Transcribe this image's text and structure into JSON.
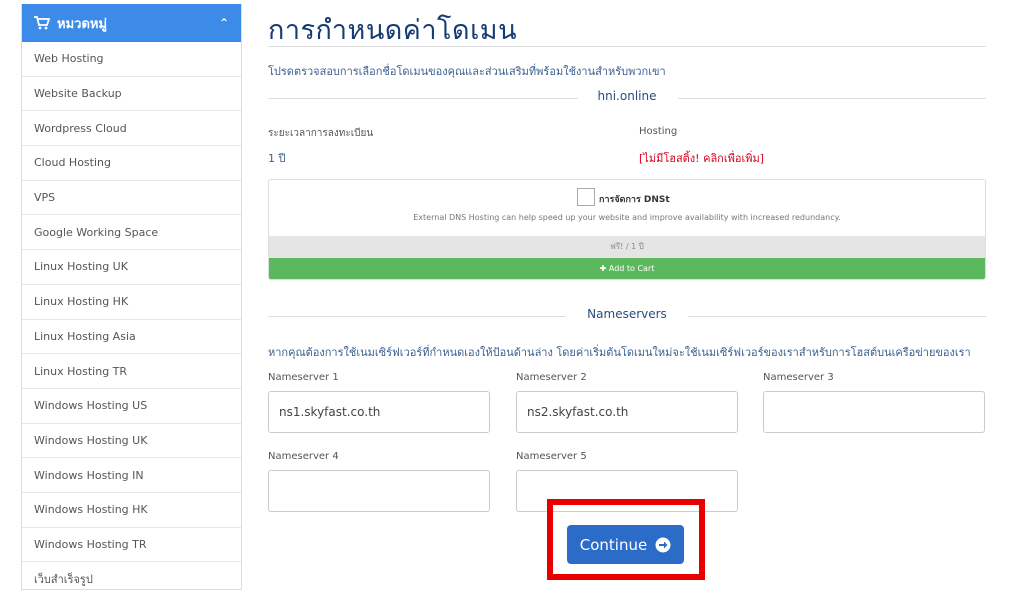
{
  "sidebar": {
    "header": "หมวดหมู่",
    "items": [
      {
        "label": "Web Hosting"
      },
      {
        "label": "Website Backup"
      },
      {
        "label": "Wordpress Cloud"
      },
      {
        "label": "Cloud Hosting"
      },
      {
        "label": "VPS"
      },
      {
        "label": "Google Working Space"
      },
      {
        "label": "Linux Hosting UK"
      },
      {
        "label": "Linux Hosting HK"
      },
      {
        "label": "Linux Hosting Asia"
      },
      {
        "label": "Linux Hosting TR"
      },
      {
        "label": "Windows Hosting US"
      },
      {
        "label": "Windows Hosting UK"
      },
      {
        "label": "Windows Hosting IN"
      },
      {
        "label": "Windows Hosting HK"
      },
      {
        "label": "Windows Hosting TR"
      },
      {
        "label": "เว็บสำเร็จรูป"
      }
    ]
  },
  "main": {
    "title": "การกำหนดค่าโดเมน",
    "subtitle": "โปรดตรวจสอบการเลือกชื่อโดเมนของคุณและส่วนเสริมที่พร้อมใช้งานสำหรับพวกเขา",
    "domain": "hni.online",
    "registration_label": "ระยะเวลาการลงทะเบียน",
    "registration_value": "1 ปี",
    "hosting_label": "Hosting",
    "hosting_value": "[ไม่มีโฮสติ้ง! คลิกเพื่อเพิ่ม]",
    "dns": {
      "title": "การจัดการ DNSt",
      "description": "External DNS Hosting can help speed up your website and improve availability with increased redundancy.",
      "price": "ฟรี! / 1 ปี",
      "add_to_cart": "Add to Cart"
    },
    "nameservers_heading": "Nameservers",
    "nameservers_desc": "หากคุณต้องการใช้เนมเซิร์ฟเวอร์ที่กำหนดเองให้ป้อนด้านล่าง โดยค่าเริ่มต้นโดเมนใหม่จะใช้เนมเซิร์ฟเวอร์ของเราสำหรับการโฮสต์บนเครือข่ายของเรา",
    "nameservers": [
      {
        "label": "Nameserver 1",
        "value": "ns1.skyfast.co.th"
      },
      {
        "label": "Nameserver 2",
        "value": "ns2.skyfast.co.th"
      },
      {
        "label": "Nameserver 3",
        "value": ""
      },
      {
        "label": "Nameserver 4",
        "value": ""
      },
      {
        "label": "Nameserver 5",
        "value": ""
      }
    ],
    "continue_label": "Continue"
  },
  "colors": {
    "sidebar_header": "#3d8be8",
    "title": "#173c73",
    "hosting_link": "#d9001b",
    "add_to_cart": "#5cb85c",
    "continue_button": "#2a6cc8",
    "highlight": "#e80000"
  },
  "icons": {
    "sidebar_header": "cart-icon",
    "sidebar_toggle": "chevron-up-icon",
    "add_to_cart": "plus-icon",
    "continue": "arrow-circle-right-icon"
  }
}
